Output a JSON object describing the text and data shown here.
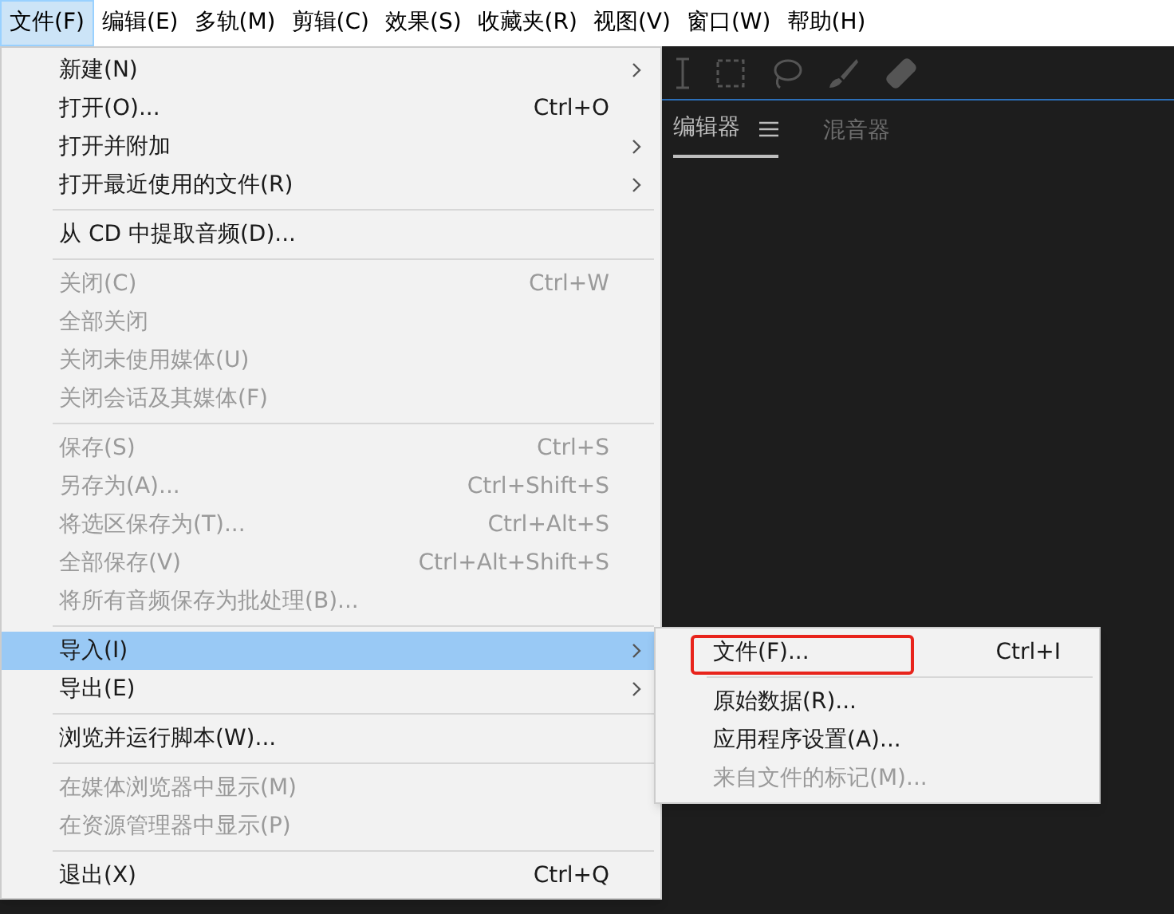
{
  "menubar": [
    {
      "label": "文件(F)",
      "selected": true
    },
    {
      "label": "编辑(E)",
      "selected": false
    },
    {
      "label": "多轨(M)",
      "selected": false
    },
    {
      "label": "剪辑(C)",
      "selected": false
    },
    {
      "label": "效果(S)",
      "selected": false
    },
    {
      "label": "收藏夹(R)",
      "selected": false
    },
    {
      "label": "视图(V)",
      "selected": false
    },
    {
      "label": "窗口(W)",
      "selected": false
    },
    {
      "label": "帮助(H)",
      "selected": false
    }
  ],
  "panel_tabs": [
    {
      "label": "编辑器",
      "selected": true,
      "has_menu": true
    },
    {
      "label": "混音器",
      "selected": false,
      "has_menu": false
    }
  ],
  "file_menu": {
    "groups": [
      [
        {
          "label": "新建(N)",
          "submenu": true,
          "disabled": false,
          "selected": false
        },
        {
          "label": "打开(O)...",
          "shortcut": "Ctrl+O",
          "submenu": false,
          "disabled": false,
          "selected": false
        },
        {
          "label": "打开并附加",
          "submenu": true,
          "disabled": false,
          "selected": false
        },
        {
          "label": "打开最近使用的文件(R)",
          "submenu": true,
          "disabled": false,
          "selected": false
        }
      ],
      [
        {
          "label": "从 CD 中提取音频(D)...",
          "submenu": false,
          "disabled": false,
          "selected": false
        }
      ],
      [
        {
          "label": "关闭(C)",
          "shortcut": "Ctrl+W",
          "submenu": false,
          "disabled": true,
          "selected": false
        },
        {
          "label": "全部关闭",
          "submenu": false,
          "disabled": true,
          "selected": false
        },
        {
          "label": "关闭未使用媒体(U)",
          "submenu": false,
          "disabled": true,
          "selected": false
        },
        {
          "label": "关闭会话及其媒体(F)",
          "submenu": false,
          "disabled": true,
          "selected": false
        }
      ],
      [
        {
          "label": "保存(S)",
          "shortcut": "Ctrl+S",
          "submenu": false,
          "disabled": true,
          "selected": false
        },
        {
          "label": "另存为(A)...",
          "shortcut": "Ctrl+Shift+S",
          "submenu": false,
          "disabled": true,
          "selected": false
        },
        {
          "label": "将选区保存为(T)...",
          "shortcut": "Ctrl+Alt+S",
          "submenu": false,
          "disabled": true,
          "selected": false
        },
        {
          "label": "全部保存(V)",
          "shortcut": "Ctrl+Alt+Shift+S",
          "submenu": false,
          "disabled": true,
          "selected": false
        },
        {
          "label": "将所有音频保存为批处理(B)...",
          "submenu": false,
          "disabled": true,
          "selected": false
        }
      ],
      [
        {
          "label": "导入(I)",
          "submenu": true,
          "disabled": false,
          "selected": true
        },
        {
          "label": "导出(E)",
          "submenu": true,
          "disabled": false,
          "selected": false
        }
      ],
      [
        {
          "label": "浏览并运行脚本(W)...",
          "submenu": false,
          "disabled": false,
          "selected": false
        }
      ],
      [
        {
          "label": "在媒体浏览器中显示(M)",
          "submenu": false,
          "disabled": true,
          "selected": false
        },
        {
          "label": "在资源管理器中显示(P)",
          "submenu": false,
          "disabled": true,
          "selected": false
        }
      ],
      [
        {
          "label": "退出(X)",
          "shortcut": "Ctrl+Q",
          "submenu": false,
          "disabled": false,
          "selected": false
        }
      ]
    ]
  },
  "import_submenu": {
    "groups": [
      [
        {
          "label": "文件(F)...",
          "shortcut": "Ctrl+I",
          "disabled": false,
          "annotated": true
        }
      ],
      [
        {
          "label": "原始数据(R)...",
          "disabled": false,
          "annotated": false
        },
        {
          "label": "应用程序设置(A)...",
          "disabled": false,
          "annotated": false
        },
        {
          "label": "来自文件的标记(M)...",
          "disabled": true,
          "annotated": false
        }
      ]
    ]
  }
}
